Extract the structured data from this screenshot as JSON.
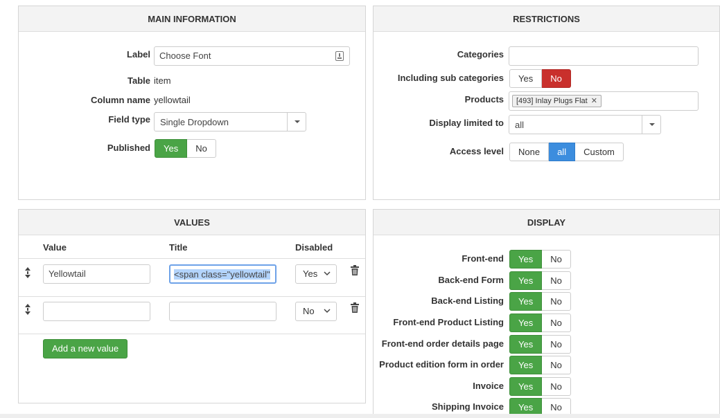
{
  "main": {
    "title": "MAIN INFORMATION",
    "label_label": "Label",
    "label_value": "Choose Font",
    "table_label": "Table",
    "table_value": "item",
    "column_label": "Column name",
    "column_value": "yellowtail",
    "fieldtype_label": "Field type",
    "fieldtype_value": "Single Dropdown",
    "published_label": "Published",
    "published_yes": "Yes",
    "published_no": "No"
  },
  "restrictions": {
    "title": "RESTRICTIONS",
    "categories_label": "Categories",
    "subcat_label": "Including sub categories",
    "subcat_yes": "Yes",
    "subcat_no": "No",
    "products_label": "Products",
    "product_tag": "[493] Inlay Plugs Flat",
    "display_limited_label": "Display limited to",
    "display_limited_value": "all",
    "access_label": "Access level",
    "access_none": "None",
    "access_all": "all",
    "access_custom": "Custom"
  },
  "values": {
    "title": "VALUES",
    "col_value": "Value",
    "col_title": "Title",
    "col_disabled": "Disabled",
    "rows": [
      {
        "value": "Yellowtail",
        "title": "<span class=\"yellowtail\"",
        "disabled": "Yes"
      },
      {
        "value": "",
        "title": "",
        "disabled": "No"
      }
    ],
    "add_label": "Add a new value"
  },
  "display": {
    "title": "DISPLAY",
    "yes": "Yes",
    "no": "No",
    "items": [
      "Front-end",
      "Back-end Form",
      "Back-end Listing",
      "Front-end Product Listing",
      "Front-end order details page",
      "Product edition form in order",
      "Invoice",
      "Shipping Invoice"
    ]
  },
  "colors": {
    "green": "#4aa446",
    "red": "#c9302c",
    "blue": "#3c8dde",
    "selection": "#b3d4fc"
  }
}
